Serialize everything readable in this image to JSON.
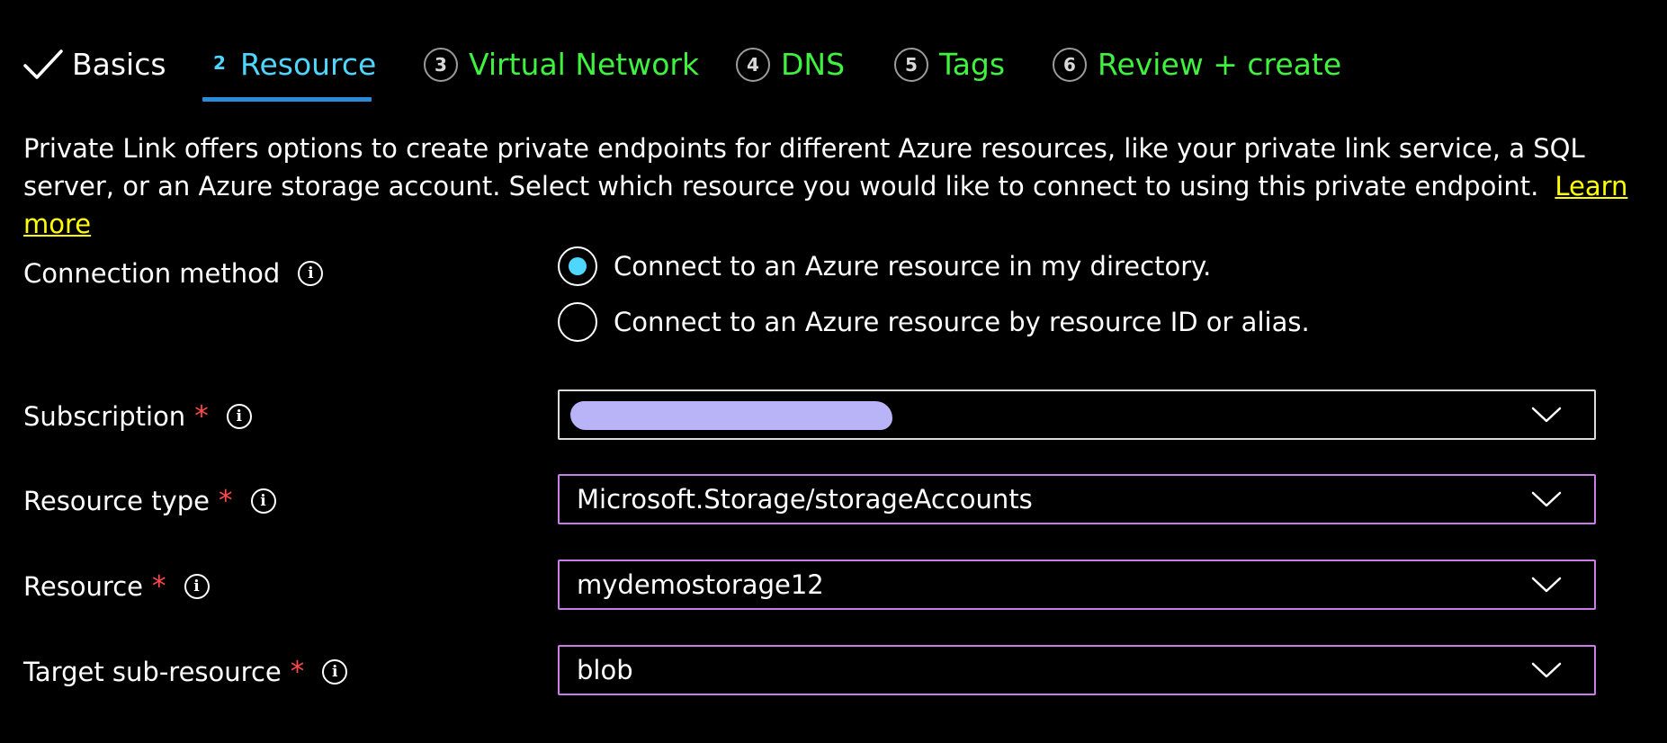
{
  "tabs": [
    {
      "step": "",
      "label": "Basics",
      "state": "done"
    },
    {
      "step": "2",
      "label": "Resource",
      "state": "current"
    },
    {
      "step": "3",
      "label": "Virtual Network",
      "state": "pending"
    },
    {
      "step": "4",
      "label": "DNS",
      "state": "pending"
    },
    {
      "step": "5",
      "label": "Tags",
      "state": "pending"
    },
    {
      "step": "6",
      "label": "Review + create",
      "state": "pending"
    }
  ],
  "description": {
    "text": "Private Link offers options to create private endpoints for different Azure resources, like your private link service, a SQL server, or an Azure storage account. Select which resource you would like to connect to using this private endpoint.",
    "link": "Learn more"
  },
  "connection_method": {
    "label": "Connection method",
    "options": [
      {
        "label": "Connect to an Azure resource in my directory.",
        "checked": true
      },
      {
        "label": "Connect to an Azure resource by resource ID or alias.",
        "checked": false
      }
    ]
  },
  "fields": {
    "subscription": {
      "label": "Subscription",
      "required": "*",
      "value": ""
    },
    "resource_type": {
      "label": "Resource type",
      "required": "*",
      "value": "Microsoft.Storage/storageAccounts"
    },
    "resource": {
      "label": "Resource",
      "required": "*",
      "value": "mydemostorage12"
    },
    "target_sub_resource": {
      "label": "Target sub-resource",
      "required": "*",
      "value": "blob"
    }
  },
  "colors": {
    "background": "#000000",
    "accent": "#4fd6ff",
    "pending_tab": "#3ff23f",
    "link": "#ffff00",
    "required": "#ff4a4a",
    "focus_border": "#c97de8",
    "underline": "#2a8bd8"
  }
}
